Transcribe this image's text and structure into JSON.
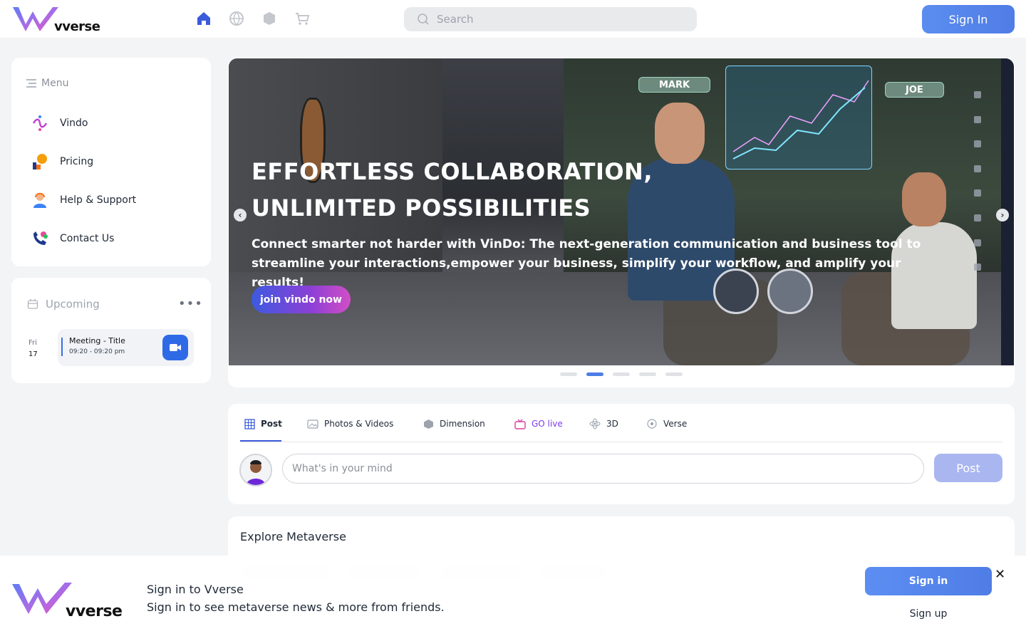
{
  "header": {
    "logo_text": "vverse",
    "nav_icons": [
      "home-icon",
      "globe-icon",
      "cube-icon",
      "cart-icon"
    ],
    "search_placeholder": "Search",
    "signin_label": "Sign In"
  },
  "menu": {
    "title": "Menu",
    "items": [
      {
        "label": "Vindo",
        "icon": "vindo-icon"
      },
      {
        "label": "Pricing",
        "icon": "pricing-icon"
      },
      {
        "label": "Help & Support",
        "icon": "support-icon"
      },
      {
        "label": "Contact Us",
        "icon": "contact-icon"
      }
    ]
  },
  "upcoming": {
    "title": "Upcoming",
    "day_name": "Fri",
    "day_num": "17",
    "meeting_title": "Meeting - Title",
    "meeting_time": "09:20 - 09:20 pm"
  },
  "hero": {
    "title_line1": "EFFORTLESS COLLABORATION,",
    "title_line2": "UNLIMITED POSSIBILITIES",
    "subtitle": "Connect smarter not harder with VinDo: The next-generation communication and business tool to streamline your interactions,empower your business, simplify your workflow, and amplify your results!",
    "button_label": "join vindo now",
    "tag_mark": "MARK",
    "tag_joe": "JOE",
    "active_slide": 2,
    "slide_count": 5
  },
  "post": {
    "tabs": [
      {
        "label": "Post",
        "icon": "grid-icon"
      },
      {
        "label": "Photos & Videos",
        "icon": "photo-icon"
      },
      {
        "label": "Dimension",
        "icon": "box-icon"
      },
      {
        "label": "GO live",
        "icon": "tv-icon"
      },
      {
        "label": "3D",
        "icon": "atom-icon"
      },
      {
        "label": "Verse",
        "icon": "verse-icon"
      }
    ],
    "placeholder": "What's in your mind",
    "post_button": "Post"
  },
  "explore": {
    "title": "Explore Metaverse"
  },
  "signin_overlay": {
    "logo_text": "vverse",
    "title": "Sign in to Vverse",
    "subtitle": "Sign in to see metaverse news & more from friends.",
    "signin_label": "Sign in",
    "signup_label": "Sign up",
    "close_icon": "close-icon"
  },
  "colors": {
    "accent": "#3b6fe0",
    "signin_gradient_start": "#5b8def",
    "golive_pink": "#d6409f"
  }
}
